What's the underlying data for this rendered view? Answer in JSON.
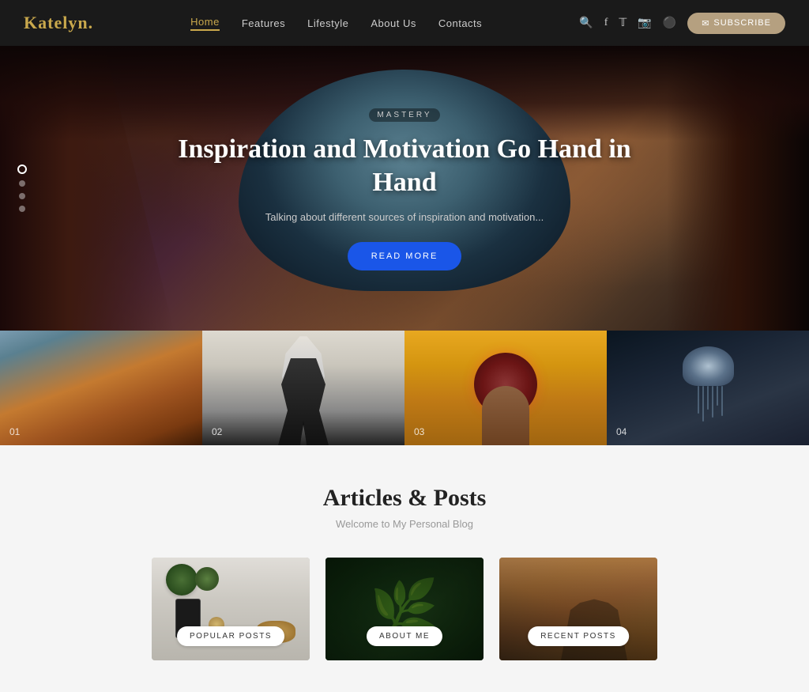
{
  "header": {
    "logo_text": "Katelyn",
    "logo_dot": ".",
    "nav": [
      {
        "label": "Home",
        "active": true
      },
      {
        "label": "Features",
        "active": false
      },
      {
        "label": "Lifestyle",
        "active": false
      },
      {
        "label": "About Us",
        "active": false
      },
      {
        "label": "Contacts",
        "active": false
      }
    ],
    "icons": [
      "search",
      "facebook",
      "twitter",
      "instagram",
      "dribbble"
    ],
    "subscribe_label": "SUBSCRIBE"
  },
  "hero": {
    "tag": "MASTERY",
    "title": "Inspiration and Motivation Go Hand in Hand",
    "subtitle": "Talking about different sources of inspiration and motivation...",
    "read_more": "READ MORE",
    "slides": [
      "1",
      "2",
      "3",
      "4"
    ]
  },
  "gallery": [
    {
      "num": "01"
    },
    {
      "num": "02"
    },
    {
      "num": "03"
    },
    {
      "num": "04"
    }
  ],
  "articles": {
    "title": "Articles & Posts",
    "subtitle": "Welcome to My Personal Blog",
    "posts": [
      {
        "label": "POPULAR POSTS"
      },
      {
        "label": "ABOUT ME"
      },
      {
        "label": "RECENT POSTS"
      }
    ]
  }
}
